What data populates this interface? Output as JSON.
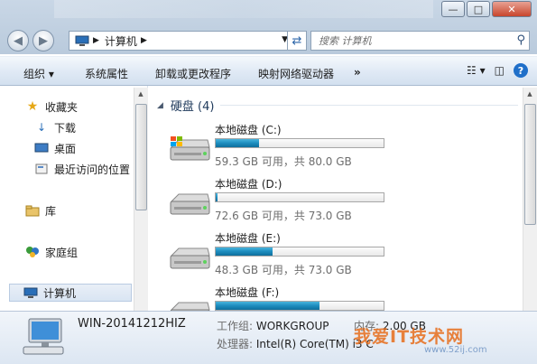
{
  "nav": {
    "address_crumb": "计算机",
    "search_placeholder": "搜索 计算机"
  },
  "toolbar": {
    "organize": "组织 ▾",
    "system_properties": "系统属性",
    "uninstall": "卸载或更改程序",
    "map_drive": "映射网络驱动器",
    "more": "»"
  },
  "sidebar": {
    "favorites": "收藏夹",
    "downloads": "下载",
    "desktop": "桌面",
    "recent": "最近访问的位置",
    "libraries": "库",
    "homegroup": "家庭组",
    "computer": "计算机"
  },
  "content": {
    "group_title": "硬盘 (4)",
    "drives": [
      {
        "name": "本地磁盘 (C:)",
        "free_text": "59.3 GB 可用，共 80.0 GB",
        "used_fraction": 0.26
      },
      {
        "name": "本地磁盘 (D:)",
        "free_text": "72.6 GB 可用，共 73.0 GB",
        "used_fraction": 0.01
      },
      {
        "name": "本地磁盘 (E:)",
        "free_text": "48.3 GB 可用，共 73.0 GB",
        "used_fraction": 0.34
      },
      {
        "name": "本地磁盘 (F:)",
        "free_text": "",
        "used_fraction": 0.62
      }
    ]
  },
  "details": {
    "hostname": "WIN-20141212HIZ",
    "workgroup_label": "工作组:",
    "workgroup_value": "WORKGROUP",
    "memory_label": "内存:",
    "memory_value": "2.00 GB",
    "cpu_label": "处理器:",
    "cpu_value": "Intel(R) Core(TM) i3 C"
  },
  "watermark": {
    "text": "我爱IT技术网",
    "url": "www.52ij.com"
  },
  "colors": {
    "accent": "#1d8cbe",
    "toolbar_bg": "#dfe9f5"
  }
}
